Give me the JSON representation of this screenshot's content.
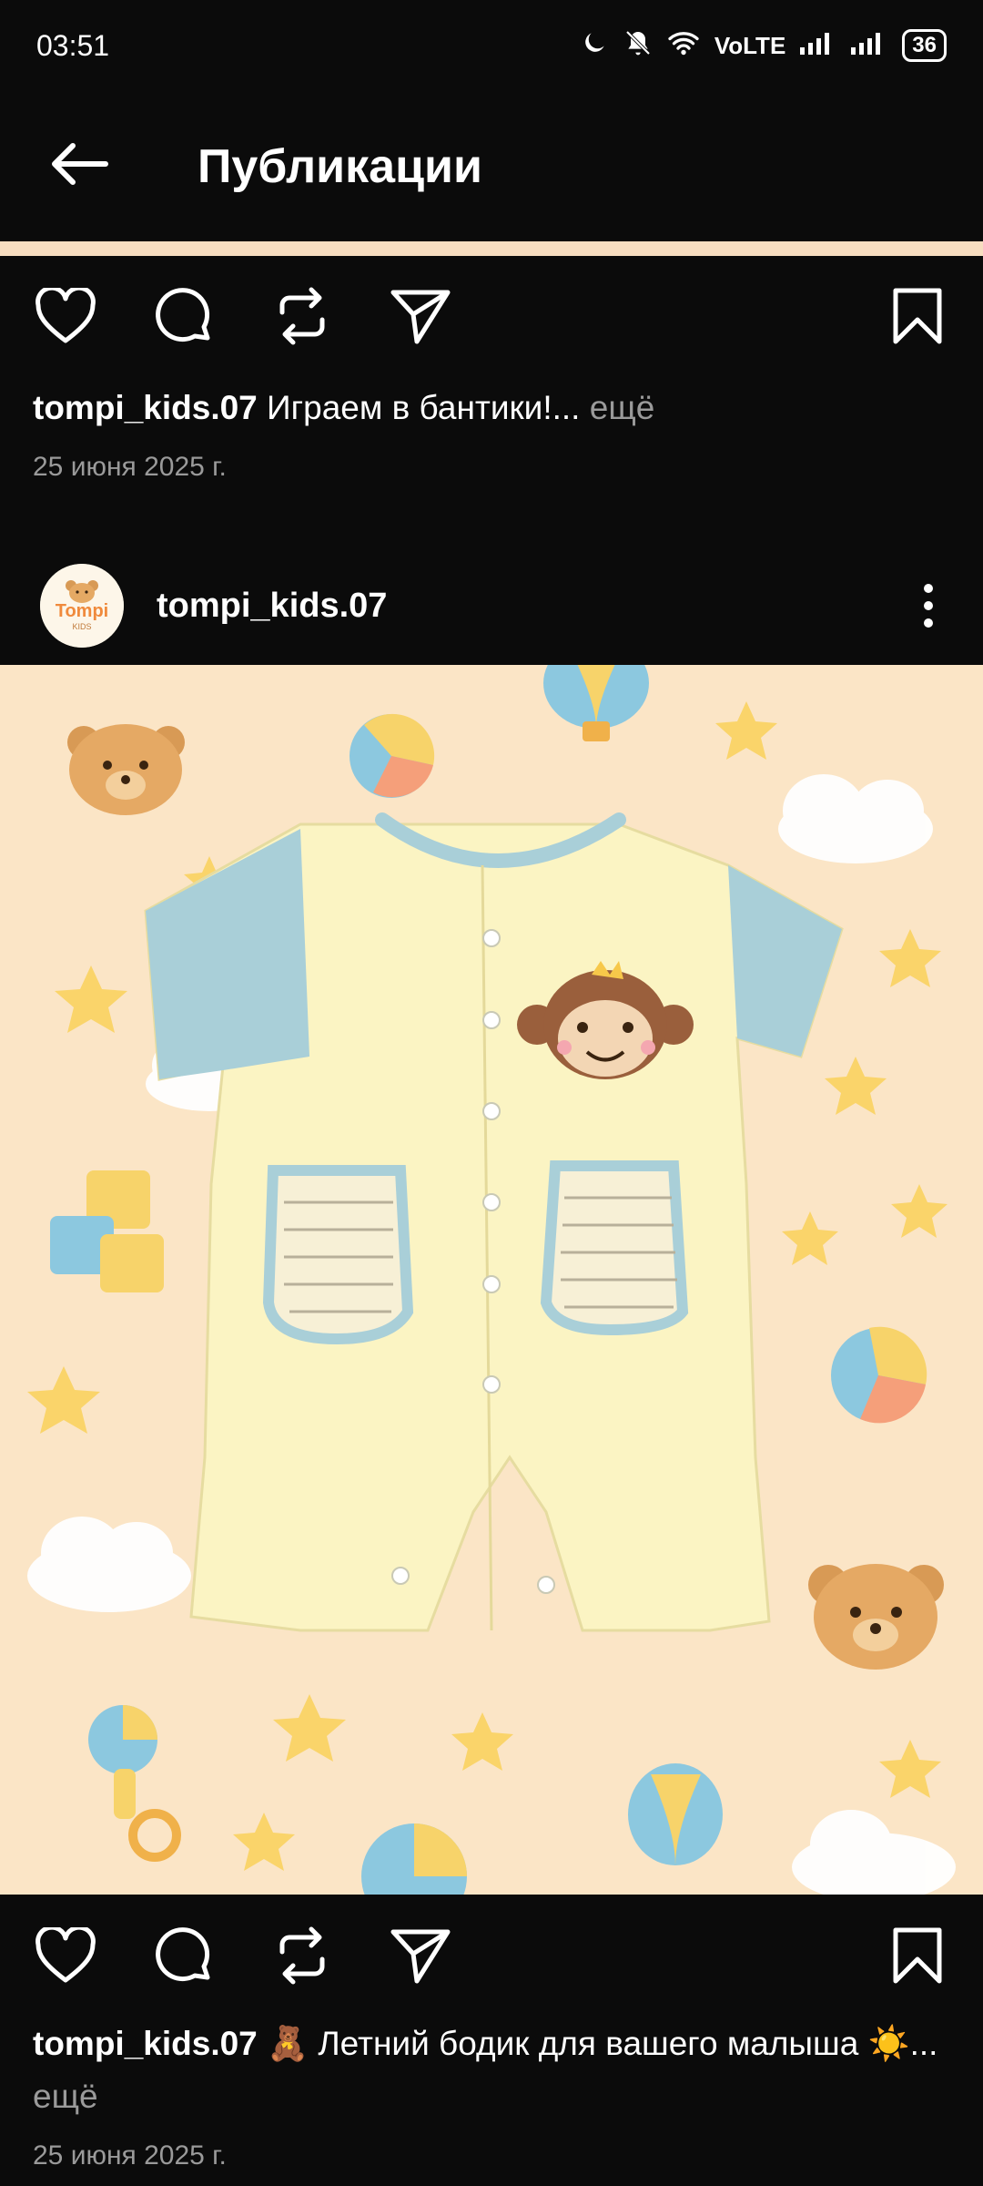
{
  "status_bar": {
    "time": "03:51",
    "network": "VoLTE",
    "battery": "36"
  },
  "app_bar": {
    "title": "Публикации"
  },
  "post_prev": {
    "username": "tompi_kids.07",
    "caption": "Играем в бантики!...",
    "more": "ещё",
    "date": "25 июня 2025 г."
  },
  "post": {
    "username": "tompi_kids.07",
    "avatar_text": "Tompi",
    "avatar_subtext": "KIDS",
    "caption": "🧸 Летний бодик для вашего малыша ☀️...",
    "more": "ещё",
    "date": "25 июня 2025 г."
  },
  "colors": {
    "background": "#0b0b0b",
    "image_bg": "#fbe5c6",
    "muted_text": "#9a9a9a"
  },
  "icons": [
    "arrow-left-icon",
    "heart-icon",
    "comment-icon",
    "repost-icon",
    "share-icon",
    "bookmark-icon",
    "more-vertical-icon"
  ]
}
